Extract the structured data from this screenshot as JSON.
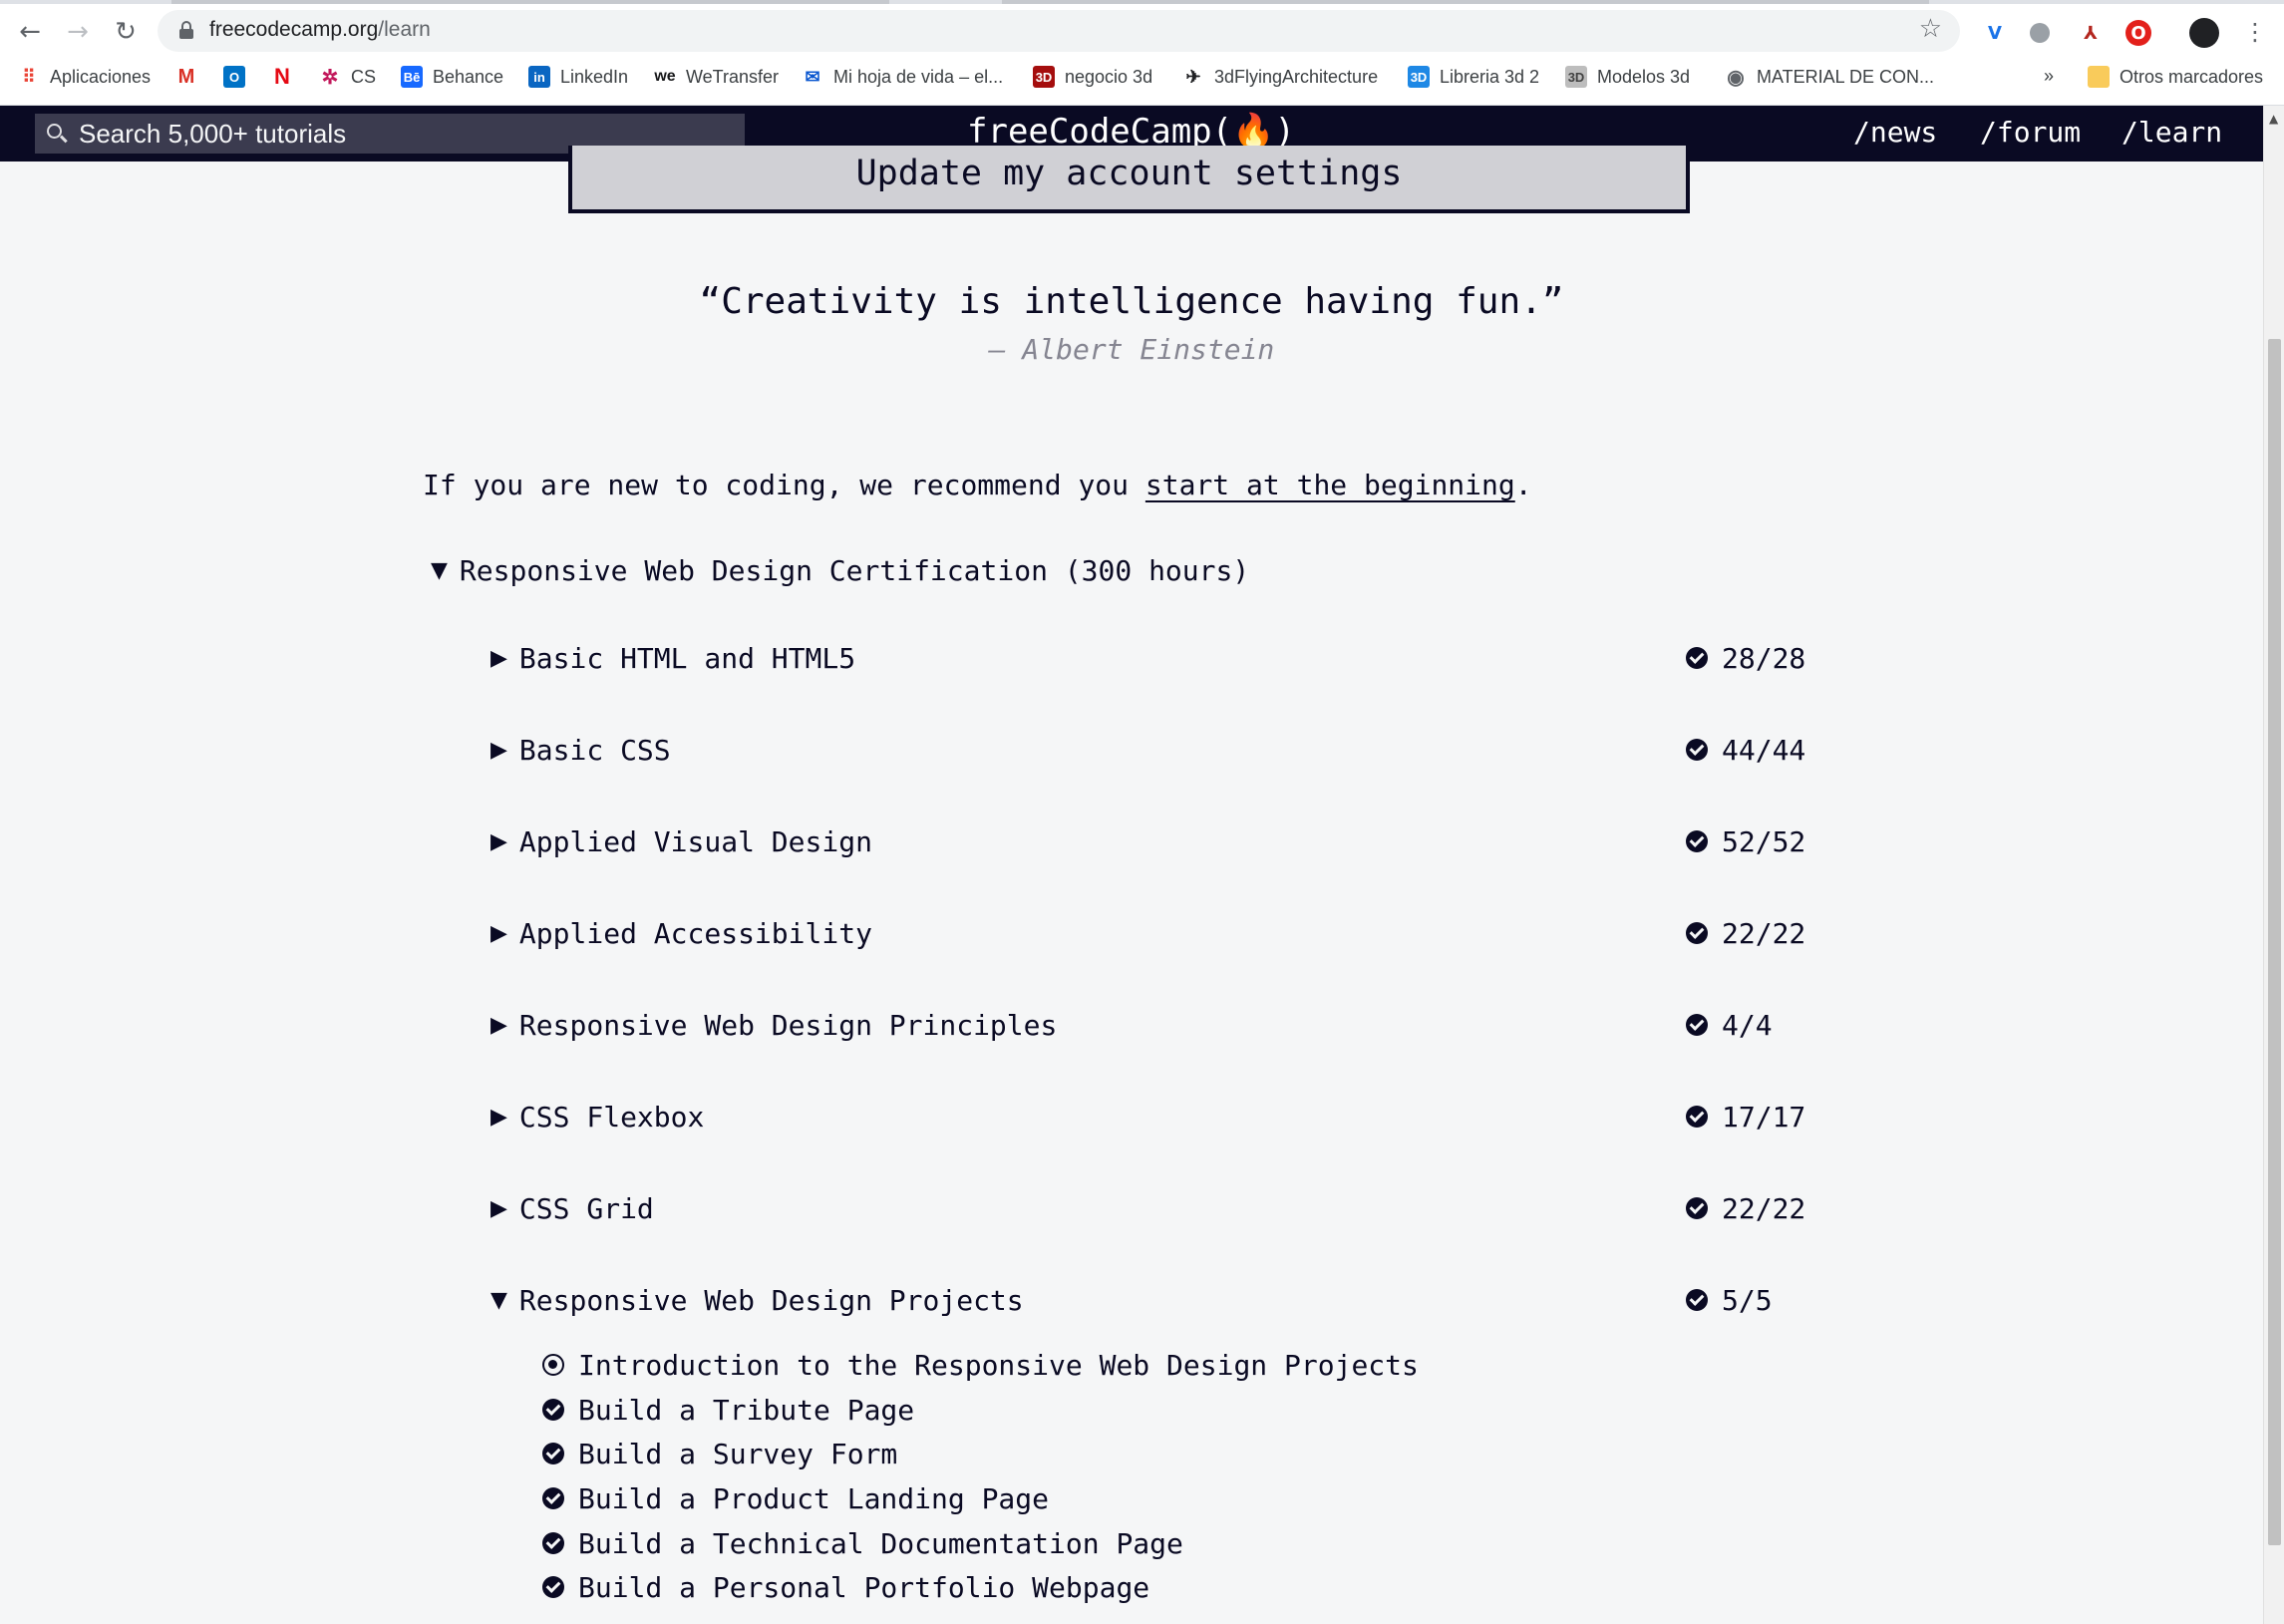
{
  "browser": {
    "url_host": "freecodecamp.org",
    "url_path": "/learn",
    "bookmarks": [
      {
        "label": "Aplicaciones",
        "icon": "apps-grid-icon"
      },
      {
        "label": "",
        "icon": "gmail-icon"
      },
      {
        "label": "",
        "icon": "outlook-icon"
      },
      {
        "label": "",
        "icon": "netflix-icon"
      },
      {
        "label": "CS",
        "icon": "cs-icon"
      },
      {
        "label": "Behance",
        "icon": "behance-icon"
      },
      {
        "label": "LinkedIn",
        "icon": "linkedin-icon"
      },
      {
        "label": "WeTransfer",
        "icon": "wetransfer-icon"
      },
      {
        "label": "Mi hoja de vida – el...",
        "icon": "mail-icon"
      },
      {
        "label": "negocio 3d",
        "icon": "3d-icon"
      },
      {
        "label": "3dFlyingArchitecture",
        "icon": "fly-icon"
      },
      {
        "label": "Libreria 3d 2",
        "icon": "3d-blue-icon"
      },
      {
        "label": "Modelos 3d",
        "icon": "3d-grey-icon"
      },
      {
        "label": "MATERIAL DE CON...",
        "icon": "globe-icon"
      }
    ],
    "overflow": "»",
    "other_bookmarks": "Otros marcadores"
  },
  "navbar": {
    "search_placeholder": "Search 5,000+ tutorials",
    "logo": "freeCodeCamp(🔥)",
    "links": [
      "/news",
      "/forum",
      "/learn"
    ]
  },
  "main": {
    "settings_button": "Update my account settings",
    "quote": "“Creativity is intelligence having fun.”",
    "author": "— Albert Einstein",
    "intro_before": "If you are new to coding, we recommend you ",
    "intro_link": "start at the beginning",
    "intro_after": ".",
    "certification": "Responsive Web Design Certification (300 hours)",
    "blocks": [
      {
        "name": "Basic HTML and HTML5",
        "progress": "28/28"
      },
      {
        "name": "Basic CSS",
        "progress": "44/44"
      },
      {
        "name": "Applied Visual Design",
        "progress": "52/52"
      },
      {
        "name": "Applied Accessibility",
        "progress": "22/22"
      },
      {
        "name": "Responsive Web Design Principles",
        "progress": "4/4"
      },
      {
        "name": "CSS Flexbox",
        "progress": "17/17"
      },
      {
        "name": "CSS Grid",
        "progress": "22/22"
      },
      {
        "name": "Responsive Web Design Projects",
        "progress": "5/5"
      }
    ],
    "challenges": [
      "Introduction to the Responsive Web Design Projects",
      "Build a Tribute Page",
      "Build a Survey Form",
      "Build a Product Landing Page",
      "Build a Technical Documentation Page",
      "Build a Personal Portfolio Webpage"
    ]
  }
}
